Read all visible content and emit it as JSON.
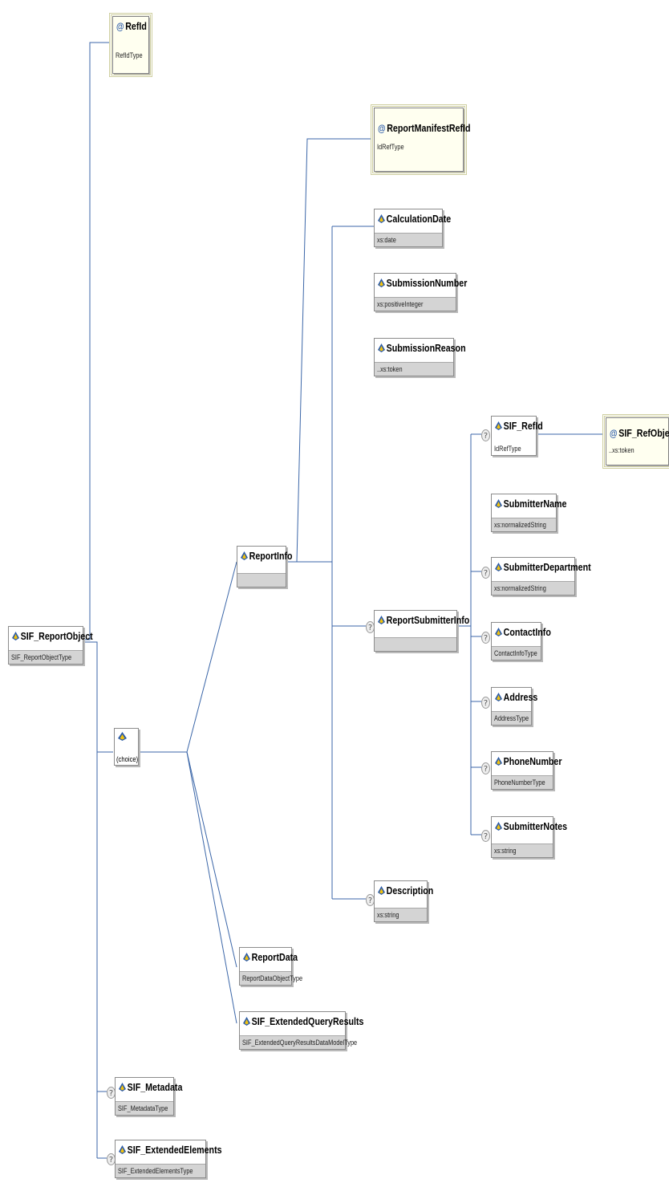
{
  "nodes": {
    "refid": {
      "name": "RefId",
      "type": "RefIdType"
    },
    "report_manifest_refid": {
      "name": "ReportManifestRefId",
      "type": "IdRefType"
    },
    "calculation_date": {
      "name": "CalculationDate",
      "type": "xs:date"
    },
    "submission_number": {
      "name": "SubmissionNumber",
      "type": "xs:positiveInteger"
    },
    "submission_reason": {
      "name": "SubmissionReason",
      "type": "..xs:token"
    },
    "sif_refid": {
      "name": "SIF_RefId",
      "type": "IdRefType"
    },
    "sif_refobject": {
      "name": "SIF_RefObject",
      "type": "..xs:token"
    },
    "submitter_name": {
      "name": "SubmitterName",
      "type": "xs:normalizedString"
    },
    "submitter_department": {
      "name": "SubmitterDepartment",
      "type": "xs:normalizedString"
    },
    "report_info": {
      "name": "ReportInfo",
      "type": ""
    },
    "report_submitter_info": {
      "name": "ReportSubmitterInfo",
      "type": ""
    },
    "contact_info": {
      "name": "ContactInfo",
      "type": "ContactInfoType"
    },
    "sif_report_object": {
      "name": "SIF_ReportObject",
      "type": "SIF_ReportObjectType"
    },
    "address": {
      "name": "Address",
      "type": "AddressType"
    },
    "phone_number": {
      "name": "PhoneNumber",
      "type": "PhoneNumberType"
    },
    "choice": {
      "name": "",
      "type": "(choice)"
    },
    "submitter_notes": {
      "name": "SubmitterNotes",
      "type": "xs:string"
    },
    "description": {
      "name": "Description",
      "type": "xs:string"
    },
    "report_data": {
      "name": "ReportData",
      "type": "ReportDataObjectType"
    },
    "sif_extended_query_results": {
      "name": "SIF_ExtendedQueryResults",
      "type": "SIF_ExtendedQueryResultsDataModelType"
    },
    "sif_metadata": {
      "name": "SIF_Metadata",
      "type": "SIF_MetadataType"
    },
    "sif_extended_elements": {
      "name": "SIF_ExtendedElements",
      "type": "SIF_ExtendedElementsType"
    }
  },
  "icons": {
    "element_icon": "element-diamond",
    "attribute_icon": "at-sign",
    "optional_icon": "question-mark"
  },
  "optional_marker": "?",
  "attribute_marker": "@",
  "colors": {
    "connector": "#3b66a8",
    "node_border": "#8c8c8c",
    "type_bar": "#d4d4d4",
    "attr_fill": "#fffff0"
  }
}
